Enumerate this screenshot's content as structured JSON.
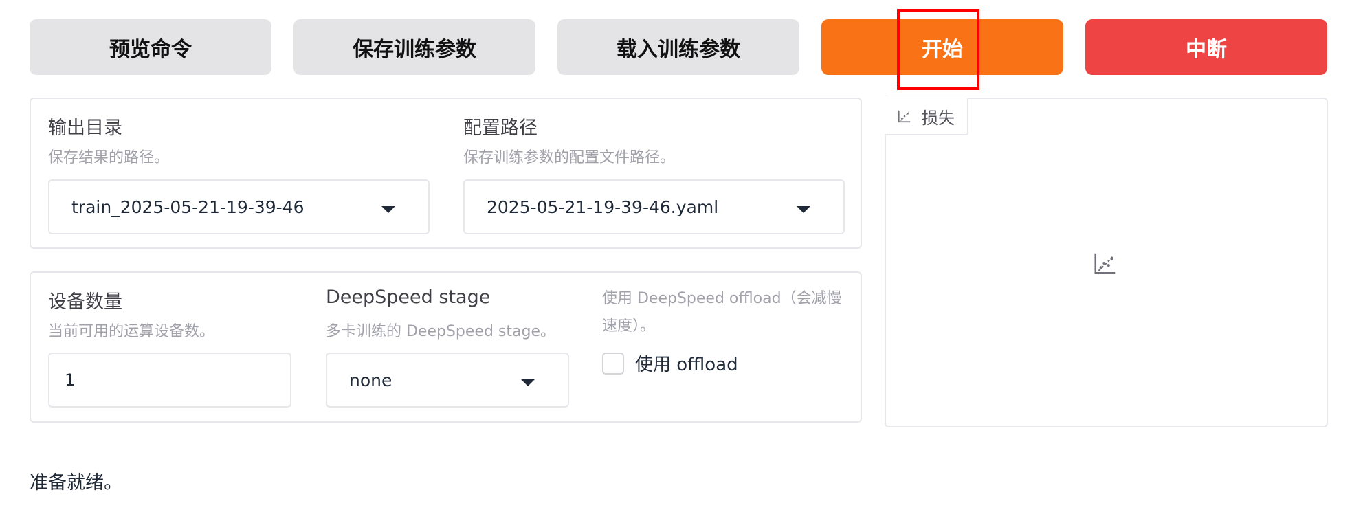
{
  "buttons": {
    "preview": "预览命令",
    "save": "保存训练参数",
    "load": "载入训练参数",
    "start": "开始",
    "abort": "中断"
  },
  "output_dir": {
    "label": "输出目录",
    "info": "保存结果的路径。",
    "value": "train_2025-05-21-19-39-46"
  },
  "config_path": {
    "label": "配置路径",
    "info": "保存训练参数的配置文件路径。",
    "value": "2025-05-21-19-39-46.yaml"
  },
  "device_count": {
    "label": "设备数量",
    "info": "当前可用的运算设备数。",
    "value": "1"
  },
  "ds_stage": {
    "label": "DeepSpeed stage",
    "info": "多卡训练的 DeepSpeed stage。",
    "value": "none"
  },
  "ds_offload": {
    "info_line1": "使用 DeepSpeed offload（会减慢",
    "info_line2": "速度）。",
    "checkbox_label": "使用 offload",
    "checked": false
  },
  "loss_plot": {
    "tab_label": "损失"
  },
  "status": "准备就绪。",
  "colors": {
    "start": "#f97316",
    "abort": "#ef4444",
    "neutral_button": "#e4e4e7",
    "highlight": "#ff0000"
  },
  "icons": {
    "plot_tab": "scatter-plot-icon",
    "plot_placeholder": "scatter-plot-icon",
    "dropdown": "caret-down-icon"
  }
}
